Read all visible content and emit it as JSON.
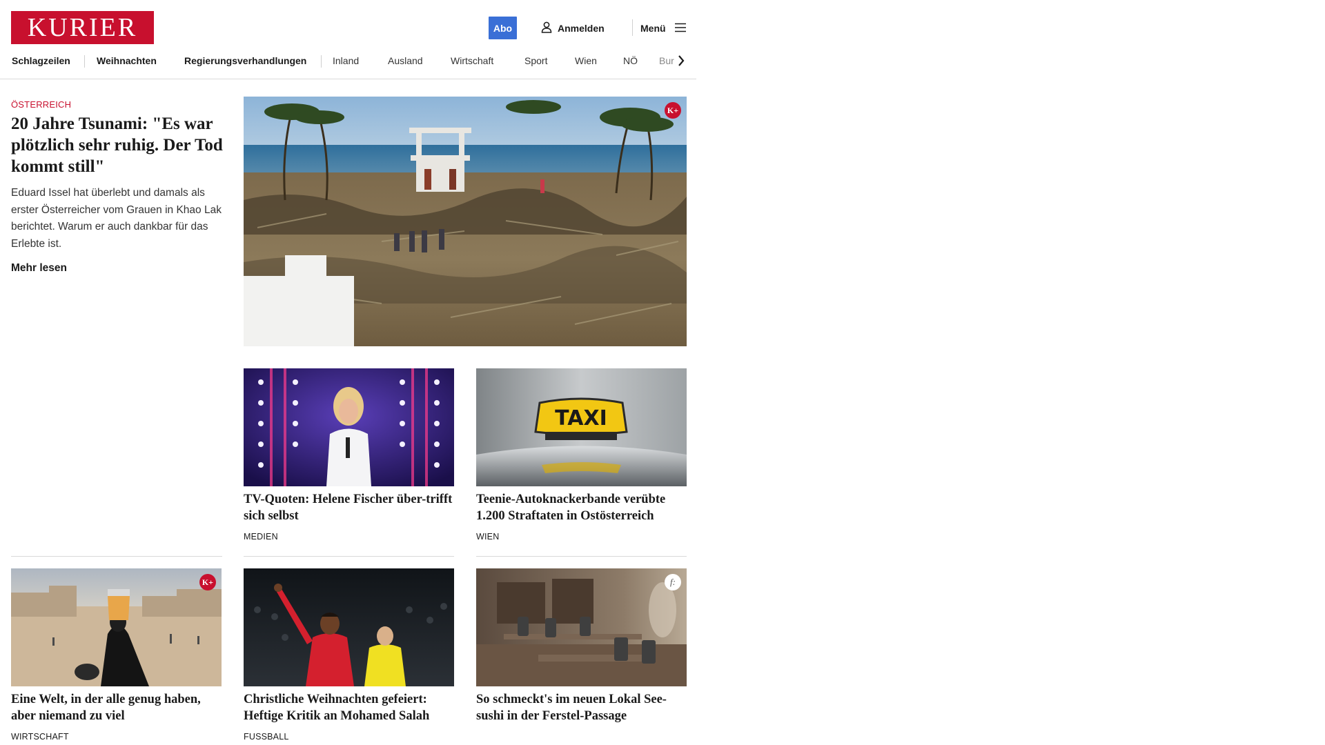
{
  "header": {
    "logo_text": "KURIER",
    "abo_label": "Abo",
    "login_label": "Anmelden",
    "menu_label": "Menü"
  },
  "nav": {
    "items": [
      "Schlagzeilen",
      "Weihnachten",
      "Regierungsverhandlungen",
      "Inland",
      "Ausland",
      "Wirtschaft",
      "Sport",
      "Wien",
      "NÖ"
    ],
    "clipped_item": "Bur"
  },
  "lead": {
    "kicker": "Österreich",
    "title": "20 Jahre Tsunami: \"Es war plötzlich sehr ruhig. Der Tod kommt still\"",
    "teaser": "Eduard Issel hat überlebt und damals als erster Österreicher vom Grauen in Khao Lak berichtet. Warum er auch dankbar für das Erlebte ist.",
    "more_label": "Mehr lesen",
    "badge": "K+"
  },
  "cards": [
    {
      "title": "TV-Quoten: Helene Fischer über-trifft sich selbst",
      "category": "Medien"
    },
    {
      "title": "Teenie-Autoknackerbande verübte 1.200 Straftaten in Ostösterreich",
      "category": "Wien"
    },
    {
      "title": "Eine Welt, in der alle genug haben, aber niemand zu viel",
      "category": "Wirtschaft",
      "badge": "K+"
    },
    {
      "title": "Christliche Weihnachten gefeiert: Heftige Kritik an Mohamed Salah",
      "category": "Fussball"
    },
    {
      "title": "So schmeckt's im neuen Lokal See-sushi in der Ferstel-Passage",
      "category": "",
      "badge": "f:"
    }
  ],
  "images": {
    "taxi_sign": "TAXI"
  },
  "colors": {
    "brand_red": "#c8102e",
    "abo_blue": "#3a6fd6"
  }
}
